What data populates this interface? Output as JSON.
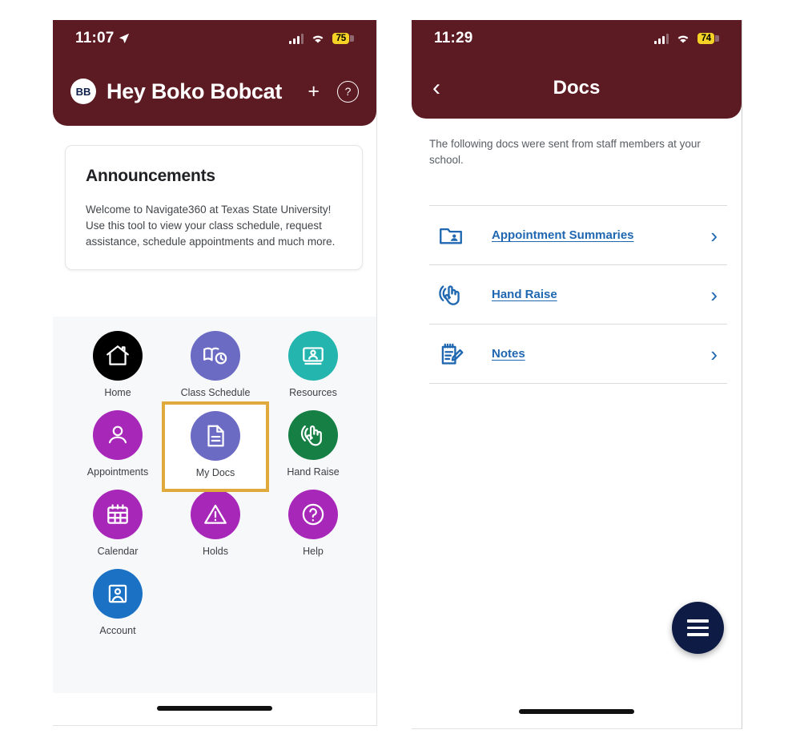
{
  "left_phone": {
    "status_bar": {
      "time": "11:07",
      "location_icon": "location-arrow-icon",
      "signal_icon": "cellular-signal-icon",
      "wifi_icon": "wifi-icon",
      "battery_level": "75",
      "battery_color": "#f5d326"
    },
    "header": {
      "avatar_initials": "BB",
      "greeting": "Hey Boko Bobcat",
      "add_label": "+",
      "help_label": "?",
      "background_color": "#5c1a22"
    },
    "announcements": {
      "title": "Announcements",
      "body": "Welcome to Navigate360 at Texas State University! Use this tool to view your class schedule, request assistance, schedule appointments and much more."
    },
    "grid": {
      "highlight_color": "#e0a93c",
      "tiles": [
        {
          "label": "Home",
          "icon": "home-icon",
          "color": "#000000",
          "selected": false
        },
        {
          "label": "Class Schedule",
          "icon": "class-schedule-icon",
          "color": "#6b6bc4",
          "selected": false
        },
        {
          "label": "Resources",
          "icon": "resources-icon",
          "color": "#23b5ae",
          "selected": false
        },
        {
          "label": "Appointments",
          "icon": "person-icon",
          "color": "#a727b8",
          "selected": false
        },
        {
          "label": "My Docs",
          "icon": "document-icon",
          "color": "#6b6bc4",
          "selected": true
        },
        {
          "label": "Hand Raise",
          "icon": "hand-raise-icon",
          "color": "#157f44",
          "selected": false
        },
        {
          "label": "Calendar",
          "icon": "calendar-icon",
          "color": "#a727b8",
          "selected": false
        },
        {
          "label": "Holds",
          "icon": "warning-icon",
          "color": "#a727b8",
          "selected": false
        },
        {
          "label": "Help",
          "icon": "question-icon",
          "color": "#a727b8",
          "selected": false
        },
        {
          "label": "Account",
          "icon": "account-card-icon",
          "color": "#1b72c4",
          "selected": false
        }
      ]
    }
  },
  "right_phone": {
    "status_bar": {
      "time": "11:29",
      "signal_icon": "cellular-signal-icon",
      "wifi_icon": "wifi-icon",
      "battery_level": "74",
      "battery_color": "#f5d326"
    },
    "header": {
      "back_label": "‹",
      "title": "Docs",
      "background_color": "#5c1a22"
    },
    "intro_text": "The following docs were sent from staff members at your school.",
    "link_color": "#1f67b1",
    "docs": [
      {
        "label": "Appointment Summaries",
        "icon": "folder-person-icon",
        "chevron": "›"
      },
      {
        "label": "Hand Raise",
        "icon": "hand-raise-icon",
        "chevron": "›"
      },
      {
        "label": "Notes",
        "icon": "notepad-pencil-icon",
        "chevron": "›"
      }
    ],
    "fab": {
      "icon": "hamburger-menu-icon",
      "color": "#0d1b45"
    }
  }
}
